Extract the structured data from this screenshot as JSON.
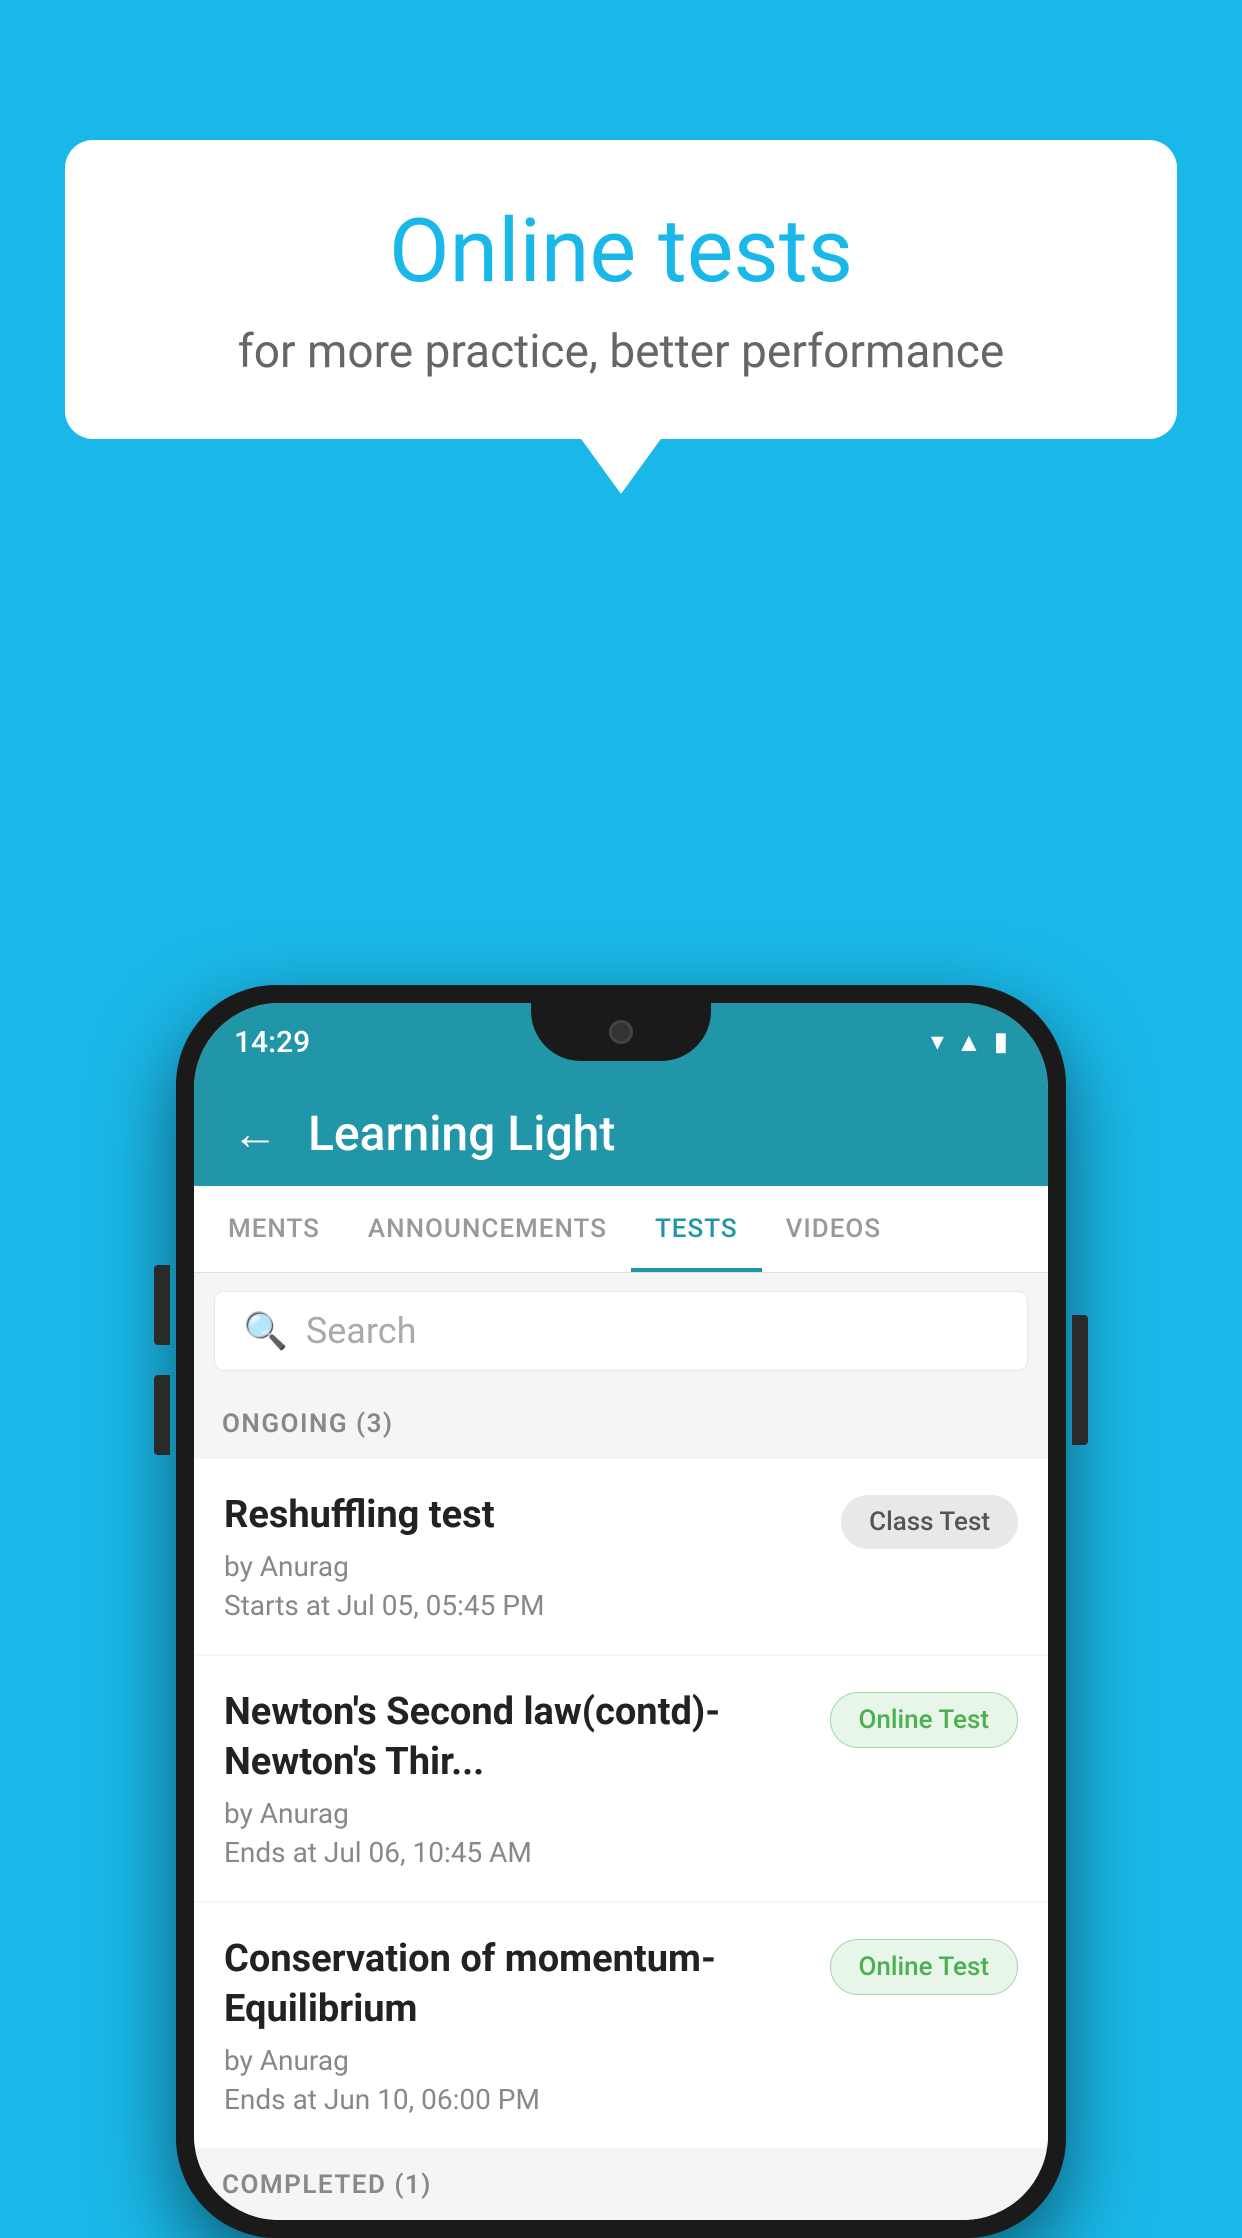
{
  "background_color": "#1ab8e8",
  "speech_bubble": {
    "title": "Online tests",
    "subtitle": "for more practice, better performance"
  },
  "phone": {
    "time": "14:29",
    "app_title": "Learning Light",
    "back_label": "←",
    "tabs": [
      {
        "label": "MENTS",
        "active": false
      },
      {
        "label": "ANNOUNCEMENTS",
        "active": false
      },
      {
        "label": "TESTS",
        "active": true
      },
      {
        "label": "VIDEOS",
        "active": false
      }
    ],
    "search": {
      "placeholder": "Search"
    },
    "ongoing_section": {
      "header": "ONGOING (3)",
      "items": [
        {
          "name": "Reshuffling test",
          "by": "by Anurag",
          "date": "Starts at  Jul 05, 05:45 PM",
          "badge": "Class Test",
          "badge_type": "class"
        },
        {
          "name": "Newton's Second law(contd)-Newton's Thir...",
          "by": "by Anurag",
          "date": "Ends at  Jul 06, 10:45 AM",
          "badge": "Online Test",
          "badge_type": "online"
        },
        {
          "name": "Conservation of momentum-Equilibrium",
          "by": "by Anurag",
          "date": "Ends at  Jun 10, 06:00 PM",
          "badge": "Online Test",
          "badge_type": "online"
        }
      ]
    },
    "completed_section": {
      "header": "COMPLETED (1)"
    }
  }
}
